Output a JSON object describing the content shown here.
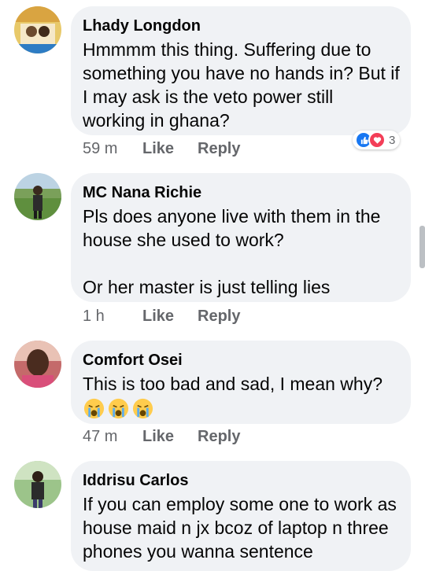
{
  "comments": [
    {
      "name": "Lhady Longdon",
      "text": "Hmmmm this thing. Suffering due to something you have no hands in? But if I may ask is the veto power still working in ghana?",
      "time": "59 m",
      "like": "Like",
      "reply": "Reply",
      "reactions": {
        "icons": [
          "like-reaction",
          "love-reaction"
        ],
        "count": "3"
      }
    },
    {
      "name": "MC Nana Richie",
      "text": "Pls does anyone live with them in the house she used to work?\n\nOr her master is just telling lies",
      "time": "1 h",
      "like": "Like",
      "reply": "Reply"
    },
    {
      "name": "Comfort Osei",
      "text": "This is too bad and sad, I mean why?",
      "emojis": [
        "😭",
        "😭",
        "😭"
      ],
      "time": "47 m",
      "like": "Like",
      "reply": "Reply"
    },
    {
      "name": "Iddrisu Carlos",
      "text": "If you can employ some one to work as house maid n jx bcoz of laptop n three phones you wanna sentence"
    }
  ],
  "colors": {
    "bubble": "#f0f2f5",
    "meta_text": "#65676b",
    "like_reaction": "#1877f2",
    "love_reaction": "#f33e58"
  }
}
